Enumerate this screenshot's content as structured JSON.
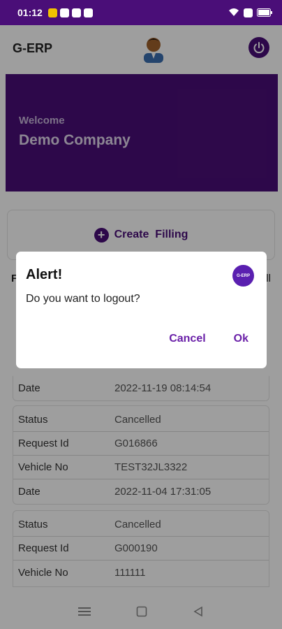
{
  "status_bar": {
    "time": "01:12",
    "icons": [
      "notification-icon",
      "gmail-icon",
      "whatsapp-icon",
      "message-icon",
      "wifi-icon",
      "sim-icon",
      "battery-icon"
    ]
  },
  "header": {
    "title": "G-ERP",
    "avatar_icon": "avatar-icon",
    "power_icon": "power-icon"
  },
  "welcome": {
    "label": "Welcome",
    "company": "Demo Company"
  },
  "create_filling": {
    "label": "Create  Filling"
  },
  "partial_heading_left": "F",
  "partial_heading_right": "ll",
  "requests": [
    {
      "rows": [
        {
          "label": "Date",
          "value": "2022-11-19 08:14:54"
        }
      ]
    },
    {
      "rows": [
        {
          "label": "Status",
          "value": "Cancelled"
        },
        {
          "label": "Request Id",
          "value": "G016866"
        },
        {
          "label": "Vehicle No",
          "value": "TEST32JL3322"
        },
        {
          "label": "Date",
          "value": "2022-11-04 17:31:05"
        }
      ]
    },
    {
      "rows": [
        {
          "label": "Status",
          "value": "Cancelled"
        },
        {
          "label": "Request Id",
          "value": "G000190"
        },
        {
          "label": "Vehicle No",
          "value": "111111"
        }
      ]
    }
  ],
  "dialog": {
    "title": "Alert!",
    "message": "Do you want to logout?",
    "cancel": "Cancel",
    "ok": "Ok",
    "logo_text": "G-ERP"
  },
  "colors": {
    "primary": "#4a0e78",
    "accent": "#6a20a8",
    "scrim": "rgba(0,0,0,0.38)"
  }
}
